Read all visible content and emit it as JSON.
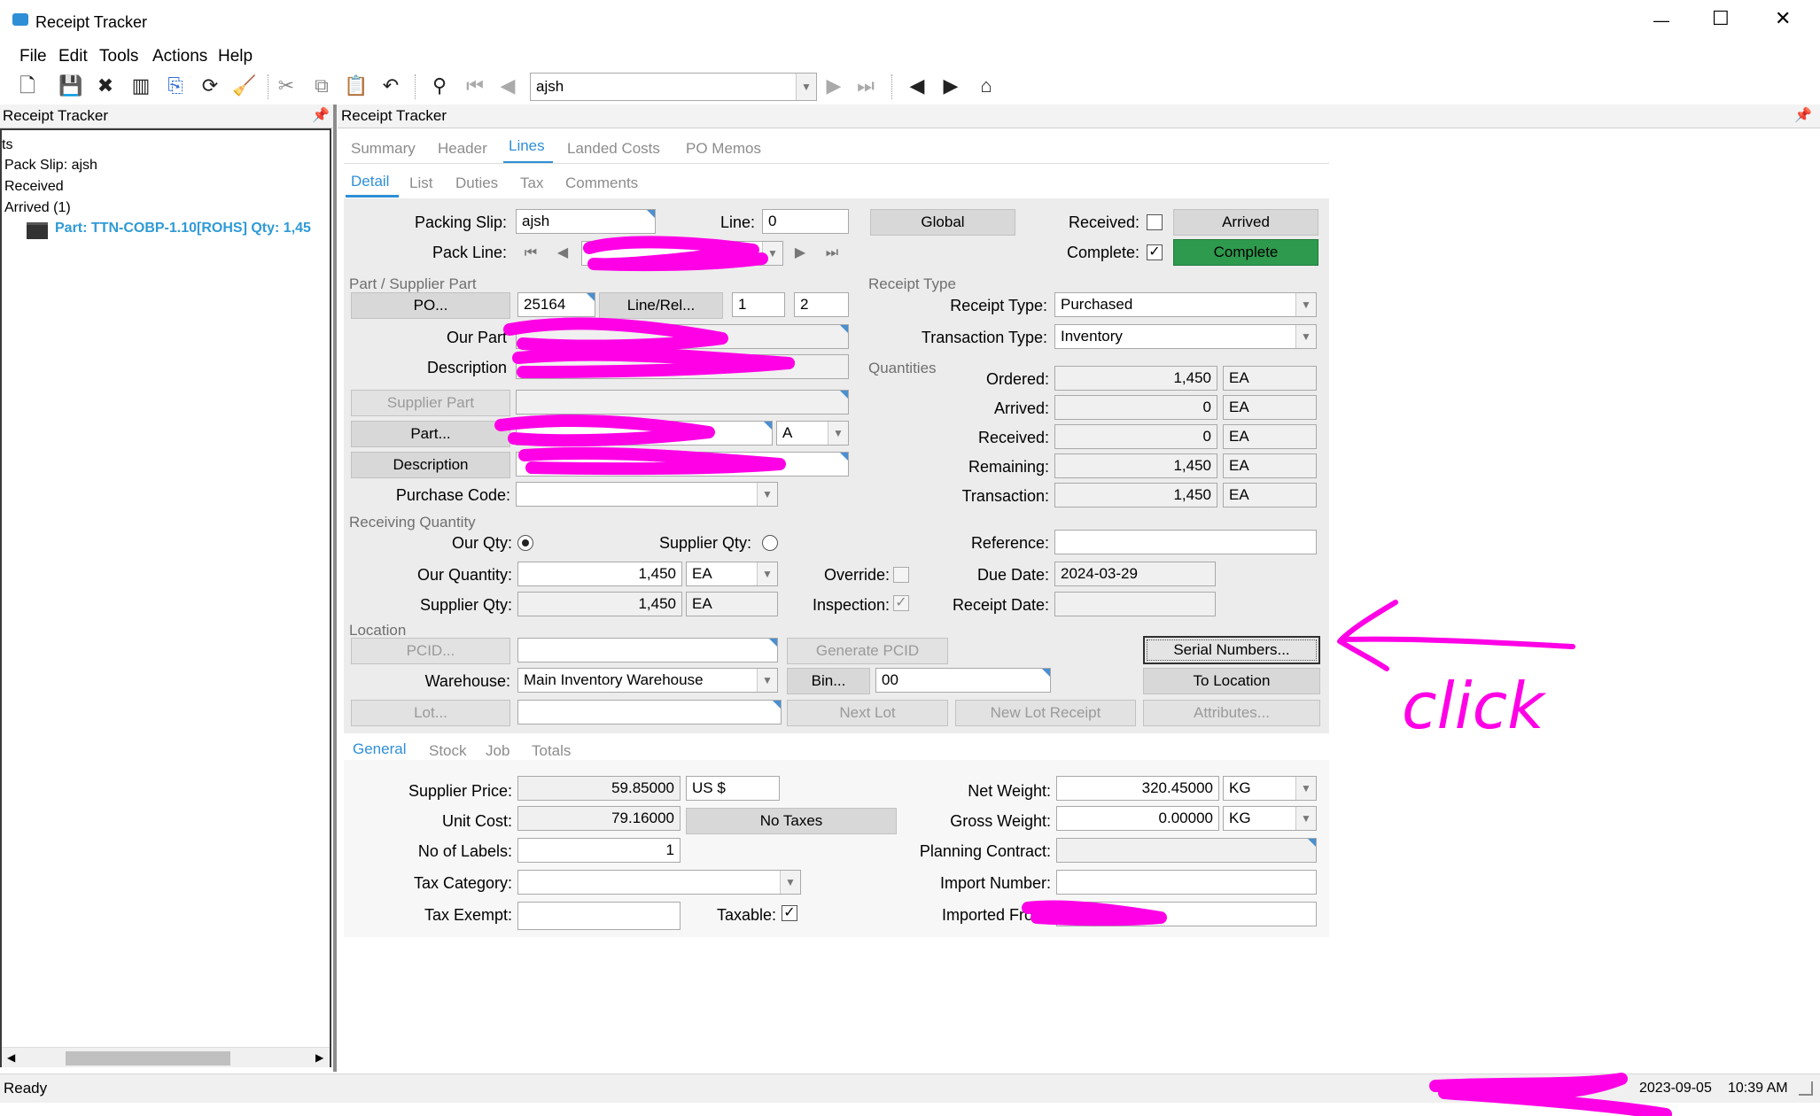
{
  "window": {
    "title": "Receipt Tracker",
    "controls": {
      "minimize": "—",
      "maximize": "☐",
      "close": "✕"
    }
  },
  "menu": [
    "File",
    "Edit",
    "Tools",
    "Actions",
    "Help"
  ],
  "toolbar": {
    "search_value": "ajsh"
  },
  "left_pane": {
    "title": "Receipt Tracker",
    "tree": {
      "root_fragment": "ts",
      "pack_slip": "Pack Slip: ajsh",
      "received": "Received",
      "arrived": "Arrived (1)",
      "part": "Part: TTN-COBP-1.10[ROHS] Qty: 1,45"
    }
  },
  "right_pane": {
    "title": "Receipt Tracker",
    "tabs": [
      "Summary",
      "Header",
      "Lines",
      "Landed Costs",
      "PO Memos"
    ],
    "active_tab": "Lines",
    "subtabs": [
      "Detail",
      "List",
      "Duties",
      "Tax",
      "Comments"
    ],
    "active_subtab": "Detail"
  },
  "form": {
    "packing_slip_label": "Packing Slip:",
    "packing_slip_value": "ajsh",
    "line_label": "Line:",
    "line_value": "0",
    "global_button": "Global",
    "received_label": "Received:",
    "received_checked": false,
    "arrived_button": "Arrived",
    "pack_line_label": "Pack Line:",
    "complete_label": "Complete:",
    "complete_checked": true,
    "complete_button": "Complete",
    "part_supplier_section": "Part / Supplier Part",
    "po_button": "PO...",
    "po_value": "25164",
    "line_rel_button": "Line/Rel...",
    "line_rel_1": "1",
    "line_rel_2": "2",
    "our_part_label": "Our Part",
    "description_label": "Description",
    "supplier_part_button": "Supplier Part",
    "part_button": "Part...",
    "part_rev": "A",
    "description_button": "Description",
    "purchase_code_label": "Purchase Code:",
    "receiving_qty_section": "Receiving Quantity",
    "our_qty_radio_label": "Our Qty:",
    "supplier_qty_radio_label": "Supplier Qty:",
    "our_quantity_label": "Our Quantity:",
    "our_quantity_value": "1,450",
    "our_quantity_uom": "EA",
    "supplier_qty_label": "Supplier Qty:",
    "supplier_qty_value": "1,450",
    "supplier_qty_uom": "EA",
    "override_label": "Override:",
    "inspection_label": "Inspection:",
    "receipt_type_section": "Receipt Type",
    "receipt_type_label": "Receipt Type:",
    "receipt_type_value": "Purchased",
    "transaction_type_label": "Transaction Type:",
    "transaction_type_value": "Inventory",
    "quantities_section": "Quantities",
    "quantities": [
      {
        "label": "Ordered:",
        "value": "1,450",
        "uom": "EA"
      },
      {
        "label": "Arrived:",
        "value": "0",
        "uom": "EA"
      },
      {
        "label": "Received:",
        "value": "0",
        "uom": "EA"
      },
      {
        "label": "Remaining:",
        "value": "1,450",
        "uom": "EA"
      },
      {
        "label": "Transaction:",
        "value": "1,450",
        "uom": "EA"
      }
    ],
    "reference_label": "Reference:",
    "due_date_label": "Due Date:",
    "due_date_value": "2024-03-29",
    "receipt_date_label": "Receipt Date:",
    "location_section": "Location",
    "pcid_button": "PCID...",
    "generate_pcid_button": "Generate PCID",
    "serial_numbers_button": "Serial Numbers...",
    "warehouse_label": "Warehouse:",
    "warehouse_value": "Main Inventory Warehouse",
    "bin_button": "Bin...",
    "bin_value": "00",
    "to_location_button": "To Location",
    "lot_button": "Lot...",
    "next_lot_button": "Next Lot",
    "new_lot_receipt_button": "New Lot Receipt",
    "attributes_button": "Attributes..."
  },
  "bottom_tabs": [
    "General",
    "Stock",
    "Job",
    "Totals"
  ],
  "active_bottom_tab": "General",
  "general": {
    "supplier_price_label": "Supplier Price:",
    "supplier_price_value": "59.85000",
    "currency": "US $",
    "unit_cost_label": "Unit Cost:",
    "unit_cost_value": "79.16000",
    "no_taxes_button": "No Taxes",
    "labels_label": "No of Labels:",
    "labels_value": "1",
    "tax_category_label": "Tax Category:",
    "tax_exempt_label": "Tax Exempt:",
    "taxable_label": "Taxable:",
    "taxable_checked": true,
    "net_weight_label": "Net Weight:",
    "net_weight_value": "320.45000",
    "net_weight_uom": "KG",
    "gross_weight_label": "Gross Weight:",
    "gross_weight_value": "0.00000",
    "gross_weight_uom": "KG",
    "planning_contract_label": "Planning Contract:",
    "import_number_label": "Import Number:",
    "imported_from_label": "Imported From:"
  },
  "status": {
    "left": "Ready",
    "date": "2023-09-05",
    "time": "10:39 AM"
  },
  "annotation": {
    "text": "click",
    "color": "#ff00e6"
  }
}
